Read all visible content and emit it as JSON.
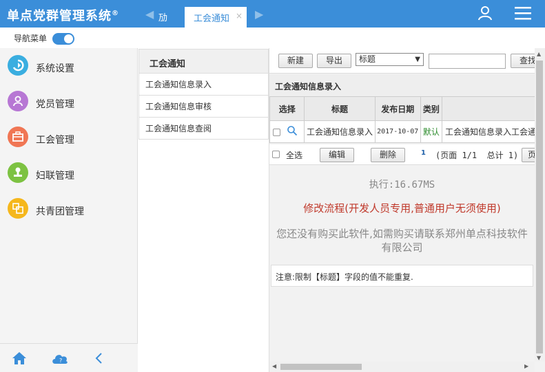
{
  "header": {
    "app_title": "单点党群管理系统",
    "app_title_mark": "®",
    "tab_stub": "劢",
    "active_tab": "工会通知",
    "tab_close": "×",
    "colors": {
      "primary": "#3b8ed9"
    }
  },
  "nav": {
    "toggle_label": "导航菜单",
    "toggle_on": true
  },
  "sidebar": {
    "items": [
      {
        "label": "系统设置",
        "icon": "settings-icon",
        "color": "#3aaee0"
      },
      {
        "label": "党员管理",
        "icon": "person-icon",
        "color": "#b777d4"
      },
      {
        "label": "工会管理",
        "icon": "briefcase-icon",
        "color": "#f07654"
      },
      {
        "label": "妇联管理",
        "icon": "stamp-icon",
        "color": "#7dc242"
      },
      {
        "label": "共青团管理",
        "icon": "group-icon",
        "color": "#f5b71d"
      }
    ],
    "bottom": [
      "home-icon",
      "cloud-help-icon",
      "collapse-icon"
    ],
    "cloud_badge": "?"
  },
  "submenu": {
    "title": "工会通知",
    "items": [
      "工会通知信息录入",
      "工会通知信息审核",
      "工会通知信息查阅"
    ]
  },
  "toolbar": {
    "new_label": "新建",
    "export_label": "导出",
    "field_select": "标题",
    "search_value": "",
    "search_label": "查找"
  },
  "section_title": "工会通知信息录入",
  "table": {
    "headers": [
      "选择",
      "标题",
      "发布日期",
      "类别",
      ""
    ],
    "rows": [
      {
        "title": "工会通知信息录入",
        "date": "2017-10-07",
        "category": "默认",
        "extra": "工会通知信息录入工会通知"
      }
    ]
  },
  "footer": {
    "select_all": "全选",
    "edit_label": "编辑",
    "delete_label": "删除",
    "page_number": "1",
    "page_info": "(页面 1/1  总计 1)",
    "page_btn": "页"
  },
  "exec_text": "执行:16.67MS",
  "modify_flow": "修改流程(开发人员专用,普通用户无须使用)",
  "purchase_notice": "您还没有购买此软件,如需购买请联系郑州单点科技软件有限公司",
  "note": "注意:限制【标题】字段的值不能重复."
}
